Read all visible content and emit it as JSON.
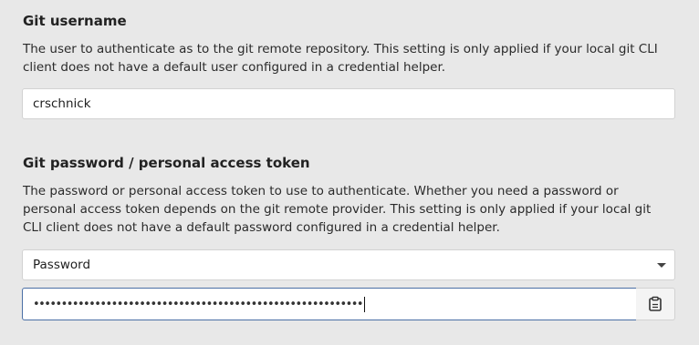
{
  "username_section": {
    "title": "Git username",
    "description": "The user to authenticate as to the git remote repository. This setting is only applied if your local git CLI client does not have a default user configured in a credential helper.",
    "value": "crschnick"
  },
  "password_section": {
    "title": "Git password / personal access token",
    "description": "The password or personal access token to use to authenticate. Whether you need a password or personal access token depends on the git remote provider. This setting is only applied if your local git CLI client does not have a default password configured in a credential helper.",
    "auth_type_selected": "Password",
    "masked_value": "•••••••••••••••••••••••••••••••••••••••••••••••••••••••••••",
    "paste_icon": "clipboard-icon"
  }
}
